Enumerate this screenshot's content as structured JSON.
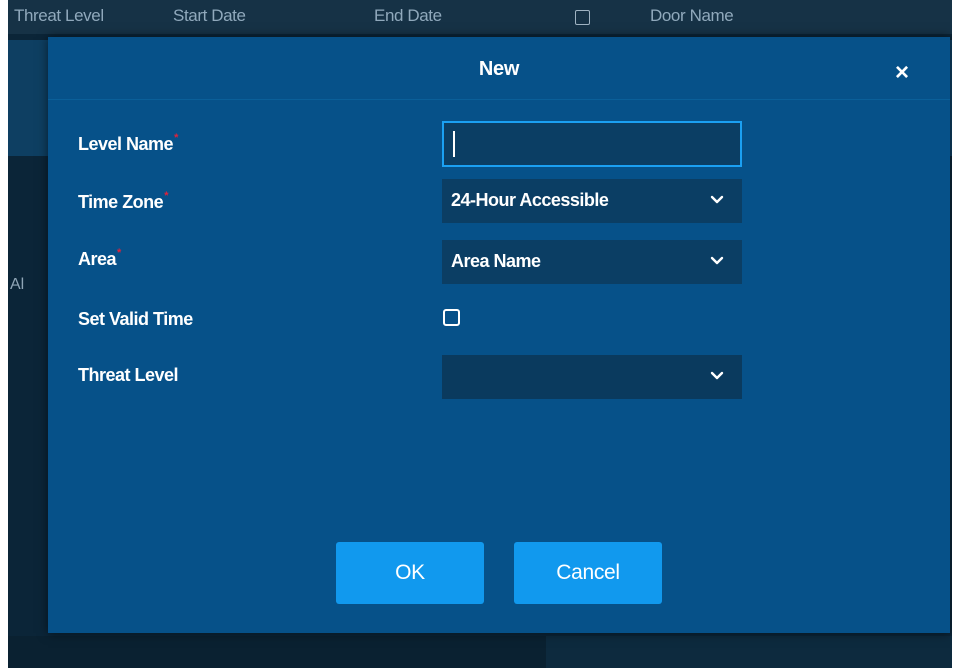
{
  "table_header": {
    "columns": [
      "Threat Level",
      "Start Date",
      "End Date",
      "Door Name"
    ]
  },
  "background": {
    "side_text": "Al"
  },
  "dialog": {
    "title": "New",
    "close_glyph": "×",
    "fields": {
      "level_name": {
        "label": "Level Name",
        "required_mark": "*",
        "value": "",
        "placeholder": ""
      },
      "time_zone": {
        "label": "Time Zone",
        "required_mark": "*",
        "selected": "24-Hour Accessible"
      },
      "area": {
        "label": "Area",
        "required_mark": "*",
        "selected": "Area Name"
      },
      "set_valid_time": {
        "label": "Set Valid Time",
        "checked": false
      },
      "threat_level": {
        "label": "Threat Level",
        "selected": ""
      }
    },
    "buttons": {
      "ok": "OK",
      "cancel": "Cancel"
    }
  },
  "icons": {
    "close": "close-icon",
    "dropdown": "chevron-down-icon",
    "checkbox": "checkbox-icon"
  },
  "colors": {
    "dialog_bg": "#065189",
    "input_bg": "#0b3e64",
    "focus_border": "#1ba0f2",
    "button_bg": "#1199ee",
    "required": "#e0223b",
    "app_bg": "#0b2538"
  }
}
